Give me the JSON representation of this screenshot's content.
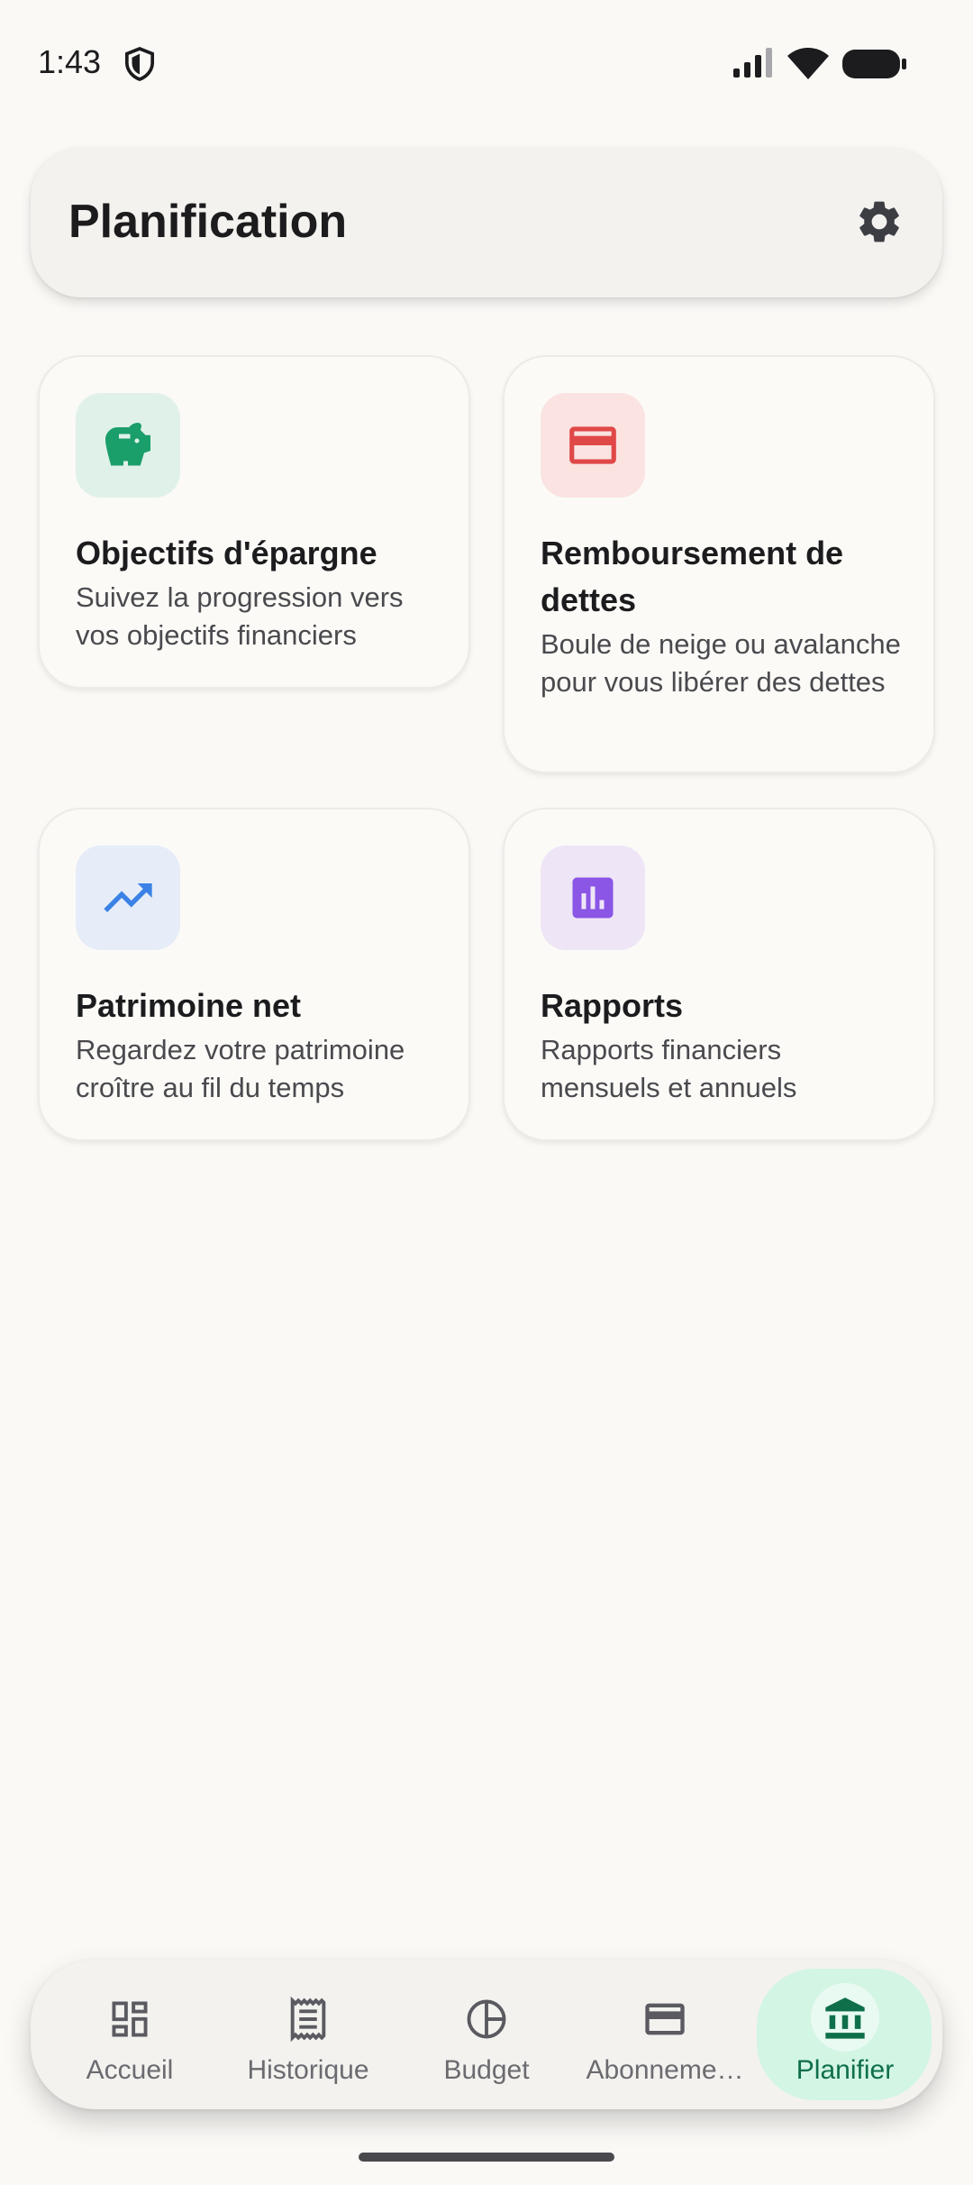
{
  "status_bar": {
    "time": "1:43"
  },
  "header": {
    "title": "Planification"
  },
  "cards": [
    {
      "title": "Objectifs d'épargne",
      "description": "Suivez la progression vers vos objectifs financiers",
      "icon": "piggy-bank-icon",
      "icon_color": "#1a9e6a",
      "icon_bg": "#e0f1e9"
    },
    {
      "title": "Remboursement de dettes",
      "description": "Boule de neige ou avalanche pour vous libérer des dettes",
      "icon": "credit-card-icon",
      "icon_color": "#e04848",
      "icon_bg": "#fae3e1"
    },
    {
      "title": "Patrimoine net",
      "description": "Regardez votre patrimoine croître au fil du temps",
      "icon": "trending-up-icon",
      "icon_color": "#3b82e6",
      "icon_bg": "#e6edf8"
    },
    {
      "title": "Rapports",
      "description": "Rapports financiers mensuels et annuels",
      "icon": "bar-chart-icon",
      "icon_color": "#8b55e6",
      "icon_bg": "#eee6f6"
    }
  ],
  "bottom_nav": {
    "items": [
      {
        "label": "Accueil",
        "icon": "dashboard-icon"
      },
      {
        "label": "Historique",
        "icon": "receipt-icon"
      },
      {
        "label": "Budget",
        "icon": "pie-chart-icon"
      },
      {
        "label": "Abonneme…",
        "icon": "card-icon"
      },
      {
        "label": "Planifier",
        "icon": "bank-icon",
        "active": true
      }
    ]
  },
  "colors": {
    "background": "#faf9f6",
    "accent": "#0e6f4a",
    "active_pill": "#d3f5e4"
  }
}
